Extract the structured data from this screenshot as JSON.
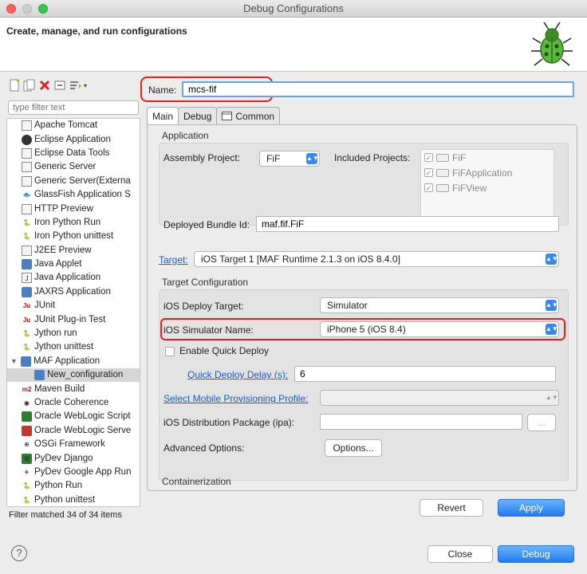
{
  "window": {
    "title": "Debug Configurations"
  },
  "banner": {
    "title": "Create, manage, and run configurations",
    "icon": "bug-icon"
  },
  "left": {
    "filter_placeholder": "type filter text",
    "tree": [
      {
        "label": "Apache Tomcat",
        "icon": "document-icon"
      },
      {
        "label": "Eclipse Application",
        "icon": "eclipse-icon"
      },
      {
        "label": "Eclipse Data Tools",
        "icon": "document-icon"
      },
      {
        "label": "Generic Server",
        "icon": "document-icon"
      },
      {
        "label": "Generic Server(Externa",
        "icon": "document-icon"
      },
      {
        "label": "GlassFish Application S",
        "icon": "glassfish-icon"
      },
      {
        "label": "HTTP Preview",
        "icon": "document-icon"
      },
      {
        "label": "Iron Python Run",
        "icon": "python-icon"
      },
      {
        "label": "Iron Python unittest",
        "icon": "python-icon"
      },
      {
        "label": "J2EE Preview",
        "icon": "document-icon"
      },
      {
        "label": "Java Applet",
        "icon": "applet-icon"
      },
      {
        "label": "Java Application",
        "icon": "java-icon"
      },
      {
        "label": "JAXRS Application",
        "icon": "jaxrs-icon"
      },
      {
        "label": "JUnit",
        "icon": "junit-icon"
      },
      {
        "label": "JUnit Plug-in Test",
        "icon": "junit-icon"
      },
      {
        "label": "Jython run",
        "icon": "python-icon"
      },
      {
        "label": "Jython unittest",
        "icon": "python-icon"
      },
      {
        "label": "MAF Application",
        "icon": "maf-icon",
        "expanded": true
      },
      {
        "label": "New_configuration",
        "icon": "maf-icon",
        "child": true,
        "selected": true
      },
      {
        "label": "Maven Build",
        "icon": "maven-icon",
        "prefix": "m2"
      },
      {
        "label": "Oracle Coherence",
        "icon": "coherence-icon"
      },
      {
        "label": "Oracle WebLogic Script",
        "icon": "weblogic-icon"
      },
      {
        "label": "Oracle WebLogic Serve",
        "icon": "weblogic-server-icon"
      },
      {
        "label": "OSGi Framework",
        "icon": "osgi-icon"
      },
      {
        "label": "PyDev Django",
        "icon": "django-icon",
        "prefix": "dj"
      },
      {
        "label": "PyDev Google App Run",
        "icon": "google-app-icon"
      },
      {
        "label": "Python Run",
        "icon": "python-icon"
      },
      {
        "label": "Python unittest",
        "icon": "python-icon"
      }
    ],
    "status": "Filter matched 34 of 34 items"
  },
  "right": {
    "name_label": "Name:",
    "name_value": "mcs-fif",
    "tabs": [
      {
        "label": "Main",
        "active": true
      },
      {
        "label": "Debug"
      },
      {
        "label": "Common"
      }
    ],
    "application": {
      "header": "Application",
      "assembly_label": "Assembly Project:",
      "assembly_value": "FiF",
      "included_label": "Included Projects:",
      "included": [
        "FiF",
        "FiFApplication",
        "FiFView"
      ],
      "bundle_label": "Deployed Bundle Id:",
      "bundle_value": "maf.fif.FiF"
    },
    "target": {
      "label": "Target:",
      "value": "iOS Target 1 [MAF Runtime 2.1.3 on iOS 8.4.0]"
    },
    "target_config": {
      "header": "Target Configuration",
      "deploy_target_label": "iOS Deploy Target:",
      "deploy_target_value": "Simulator",
      "simulator_label": "iOS Simulator Name:",
      "simulator_value": "iPhone 5 (iOS 8.4)",
      "quick_deploy_label": "Enable Quick Deploy",
      "delay_label": "Quick Deploy Delay (s):",
      "delay_value": "6",
      "provisioning_label": "Select Mobile Provisioning Profile:",
      "ipa_label": "iOS Distribution Package (ipa):",
      "ipa_browse": "...",
      "advanced_label": "Advanced Options:",
      "options_button": "Options...",
      "containerization": "Containerization"
    },
    "revert_button": "Revert",
    "apply_button": "Apply"
  },
  "footer": {
    "close_button": "Close",
    "debug_button": "Debug",
    "help": "?"
  }
}
